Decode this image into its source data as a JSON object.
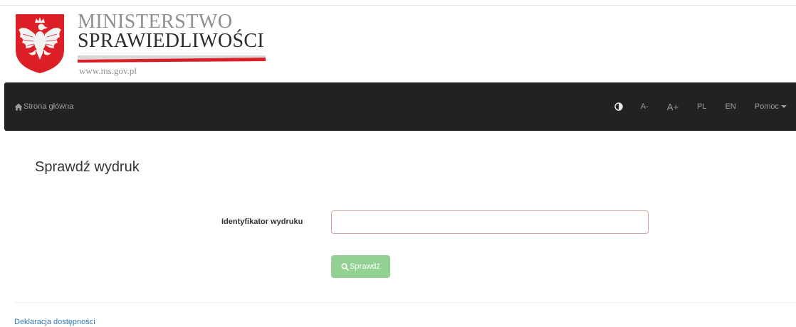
{
  "header": {
    "logo_line1": "MINISTERSTWO",
    "logo_line2": "SPRAWIEDLIWOŚCI",
    "logo_url": "www.ms.gov.pl"
  },
  "navbar": {
    "home_label": "Strona główna",
    "font_smaller_label": "A-",
    "font_larger_label": "A+",
    "lang_pl_label": "PL",
    "lang_en_label": "EN",
    "help_label": "Pomoc"
  },
  "main": {
    "title": "Sprawdź wydruk",
    "field_label": "Identyfikator wydruku",
    "field_value": "",
    "button_label": "Sprawdź"
  },
  "footer": {
    "accessibility_link": "Deklaracja dostępności"
  },
  "icons": {
    "home": "home-icon",
    "contrast": "contrast-icon",
    "search": "search-icon",
    "crest": "polish-eagle-crest"
  },
  "colors": {
    "navbar_bg": "#222222",
    "nav_text": "#9d9d9d",
    "button_bg": "#93d193",
    "input_border": "#d9a1a1",
    "link": "#337ab7",
    "crest_red": "#dc1f26"
  }
}
